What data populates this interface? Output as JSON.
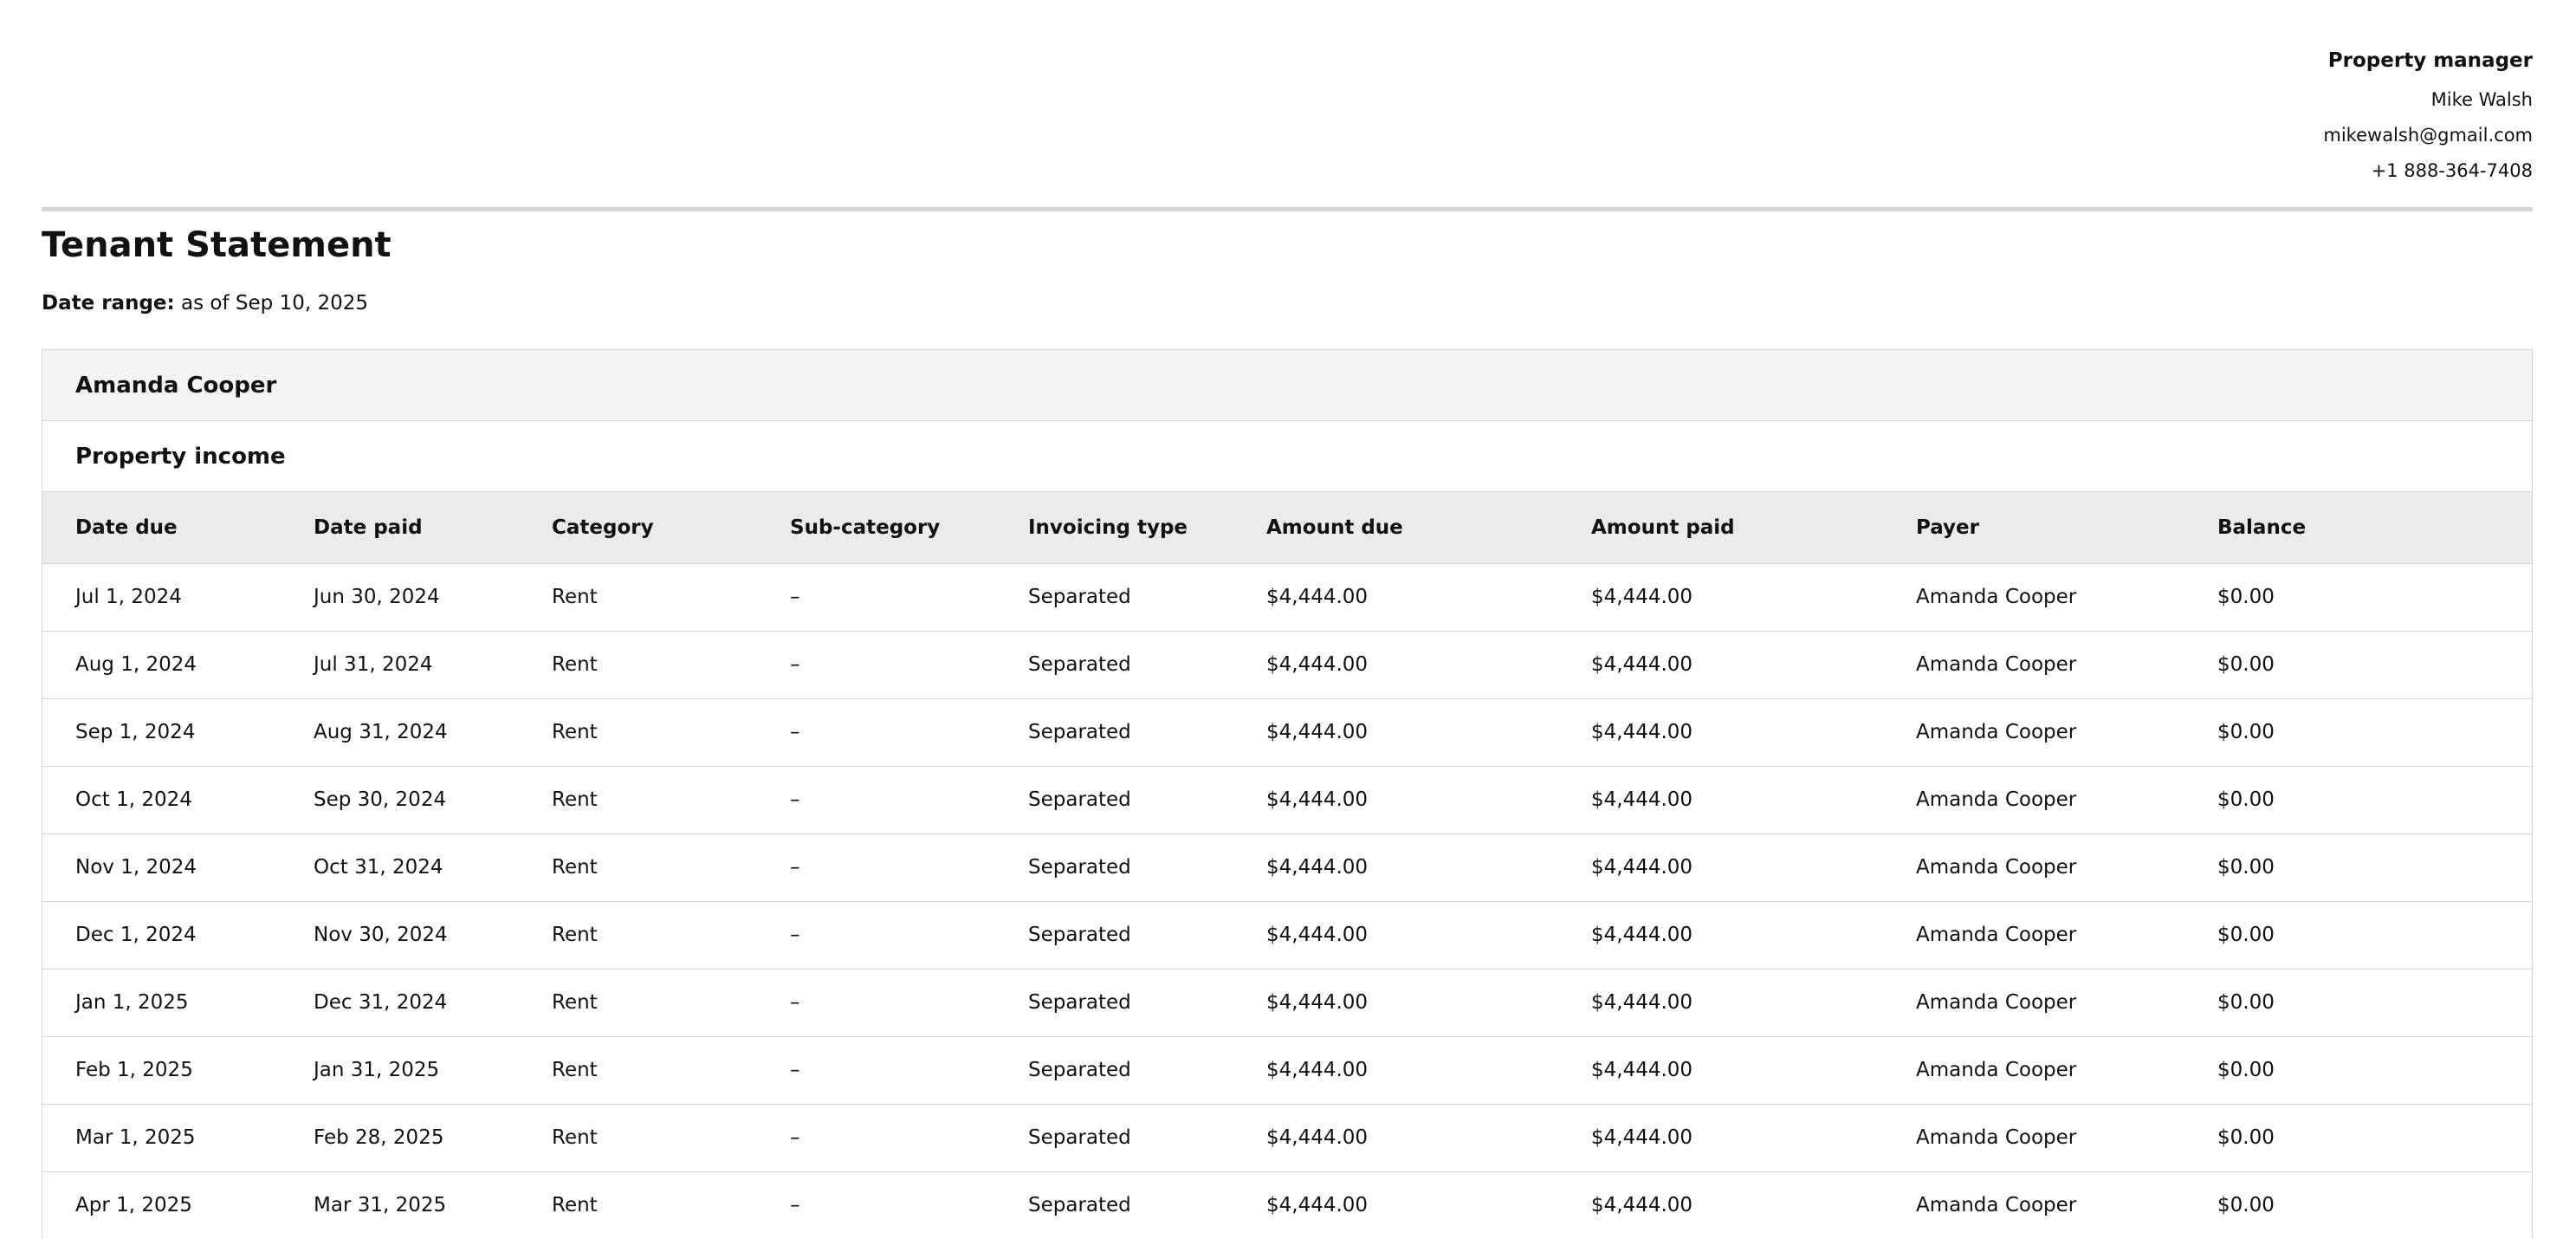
{
  "manager": {
    "label": "Property manager",
    "name": "Mike Walsh",
    "email": "mikewalsh@gmail.com",
    "phone": "+1 888-364-7408"
  },
  "statement": {
    "title": "Tenant Statement",
    "date_range_label": "Date range:",
    "date_range_value": "as of Sep 10, 2025"
  },
  "tenant": {
    "name": "Amanda Cooper"
  },
  "section": {
    "title": "Property income"
  },
  "table": {
    "columns": [
      "Date due",
      "Date paid",
      "Category",
      "Sub-category",
      "Invoicing type",
      "Amount due",
      "Amount paid",
      "Payer",
      "Balance"
    ],
    "rows": [
      [
        "Jul 1, 2024",
        "Jun 30, 2024",
        "Rent",
        "–",
        "Separated",
        "$4,444.00",
        "$4,444.00",
        "Amanda Cooper",
        "$0.00"
      ],
      [
        "Aug 1, 2024",
        "Jul 31, 2024",
        "Rent",
        "–",
        "Separated",
        "$4,444.00",
        "$4,444.00",
        "Amanda Cooper",
        "$0.00"
      ],
      [
        "Sep 1, 2024",
        "Aug 31, 2024",
        "Rent",
        "–",
        "Separated",
        "$4,444.00",
        "$4,444.00",
        "Amanda Cooper",
        "$0.00"
      ],
      [
        "Oct 1, 2024",
        "Sep 30, 2024",
        "Rent",
        "–",
        "Separated",
        "$4,444.00",
        "$4,444.00",
        "Amanda Cooper",
        "$0.00"
      ],
      [
        "Nov 1, 2024",
        "Oct 31, 2024",
        "Rent",
        "–",
        "Separated",
        "$4,444.00",
        "$4,444.00",
        "Amanda Cooper",
        "$0.00"
      ],
      [
        "Dec 1, 2024",
        "Nov 30, 2024",
        "Rent",
        "–",
        "Separated",
        "$4,444.00",
        "$4,444.00",
        "Amanda Cooper",
        "$0.00"
      ],
      [
        "Jan 1, 2025",
        "Dec 31, 2024",
        "Rent",
        "–",
        "Separated",
        "$4,444.00",
        "$4,444.00",
        "Amanda Cooper",
        "$0.00"
      ],
      [
        "Feb 1, 2025",
        "Jan 31, 2025",
        "Rent",
        "–",
        "Separated",
        "$4,444.00",
        "$4,444.00",
        "Amanda Cooper",
        "$0.00"
      ],
      [
        "Mar 1, 2025",
        "Feb 28, 2025",
        "Rent",
        "–",
        "Separated",
        "$4,444.00",
        "$4,444.00",
        "Amanda Cooper",
        "$0.00"
      ],
      [
        "Apr 1, 2025",
        "Mar 31, 2025",
        "Rent",
        "–",
        "Separated",
        "$4,444.00",
        "$4,444.00",
        "Amanda Cooper",
        "$0.00"
      ]
    ]
  }
}
